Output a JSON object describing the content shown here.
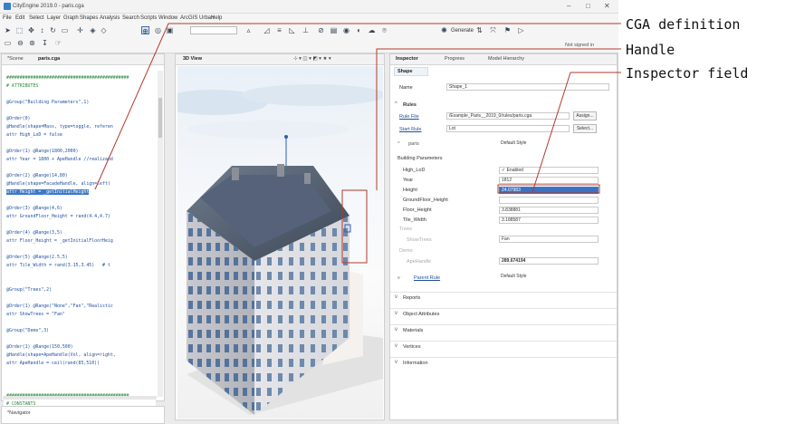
{
  "window": {
    "title": "CityEngine 2019.0 - paris.cga",
    "minimize": "–",
    "maximize": "□",
    "close": "✕"
  },
  "menu": [
    "File",
    "Edit",
    "Select",
    "Layer",
    "Graph",
    "Shapes",
    "Analysis",
    "Search",
    "Scripts",
    "Window",
    "ArcGIS Urban",
    "Help"
  ],
  "toolbar": {
    "generate_label": "Generate",
    "signin_label": "Not signed in"
  },
  "left_panel": {
    "tabs": [
      "*Scene",
      "paris.cga"
    ],
    "code": [
      {
        "text": "##############################################",
        "kind": "comment"
      },
      {
        "text": "# ATTRIBUTES",
        "kind": "comment"
      },
      {
        "text": "",
        "kind": "code"
      },
      {
        "text": "@Group(\"Building Parameters\",1)",
        "kind": "code"
      },
      {
        "text": "",
        "kind": "code"
      },
      {
        "text": "@Order(0)",
        "kind": "code"
      },
      {
        "text": "@Handle(shape=Mass, type=toggle, referen",
        "kind": "code"
      },
      {
        "text": "attr High_LoD = false",
        "kind": "code"
      },
      {
        "text": "",
        "kind": "code"
      },
      {
        "text": "@Order(1) @Range(1800,2000)",
        "kind": "code"
      },
      {
        "text": "attr Year = 1800 + ApeHandle //realizand",
        "kind": "code"
      },
      {
        "text": "",
        "kind": "code"
      },
      {
        "text": "@Order(2) @Range(14,80)",
        "kind": "code"
      },
      {
        "text": "@Handle(shape=FacadeHandle, align=left)",
        "kind": "code"
      },
      {
        "text": "attr Height = _getInitialHeight",
        "kind": "selected"
      },
      {
        "text": "",
        "kind": "code"
      },
      {
        "text": "@Order(3) @Range(4,6)",
        "kind": "code"
      },
      {
        "text": "attr GroundFloor_Height = rand(4.4,4.7)",
        "kind": "code"
      },
      {
        "text": "",
        "kind": "code"
      },
      {
        "text": "@Order(4) @Range(3,5)",
        "kind": "code"
      },
      {
        "text": "attr Floor_Height = _getInitialFloorHeig",
        "kind": "code"
      },
      {
        "text": "",
        "kind": "code"
      },
      {
        "text": "@Order(5) @Range(2.5,5)",
        "kind": "code"
      },
      {
        "text": "attr Tile_Width = rand(3.15,3.45)   # t",
        "kind": "code"
      },
      {
        "text": "",
        "kind": "code"
      },
      {
        "text": "",
        "kind": "code"
      },
      {
        "text": "@Group(\"Trees\",2)",
        "kind": "code"
      },
      {
        "text": "",
        "kind": "code"
      },
      {
        "text": "@Order(1) @Range(\"None\",\"Fan\",\"Realistic",
        "kind": "code"
      },
      {
        "text": "attr ShowTrees = \"Fan\"",
        "kind": "code"
      },
      {
        "text": "",
        "kind": "code"
      },
      {
        "text": "@Group(\"Demo\",3)",
        "kind": "code"
      },
      {
        "text": "",
        "kind": "code"
      },
      {
        "text": "@Order(1) @Range(150,500)",
        "kind": "code"
      },
      {
        "text": "@Handle(shape=ApeHandle(Vol, align=right,",
        "kind": "code"
      },
      {
        "text": "attr ApeHandle = ceil(rand(85,510))",
        "kind": "code"
      },
      {
        "text": "",
        "kind": "code"
      },
      {
        "text": "",
        "kind": "code"
      },
      {
        "text": "",
        "kind": "code"
      },
      {
        "text": "##############################################",
        "kind": "comment"
      },
      {
        "text": "# CONSTANTS",
        "kind": "comment"
      }
    ],
    "navigator_tab": "*Navigator"
  },
  "viewport": {
    "tab": "3D View"
  },
  "inspector": {
    "tabs": [
      "Inspector",
      "Progress",
      "Model Hierarchy"
    ],
    "subtab": "Shape",
    "name_label": "Name",
    "name_value": "Shape_1",
    "rules_title": "Rules",
    "rule_file_label": "Rule File",
    "rule_file_value": "/Example_Paris__2019_0/rules/paris.cga",
    "assign_label": "Assign...",
    "start_rule_label": "Start Rule",
    "start_rule_value": "Lot",
    "select_label": "Select...",
    "paris_label": "paris",
    "paris_style": "Default Style",
    "building_params_label": "Building Parameters",
    "attributes": [
      {
        "label": "High_LoD",
        "value": "✓ Enabled"
      },
      {
        "label": "Year",
        "value": "1812"
      },
      {
        "label": "Height",
        "value": "24.07983"
      },
      {
        "label": "GroundFloor_Height",
        "value": ""
      },
      {
        "label": "Floor_Height",
        "value": "3.838881"
      },
      {
        "label": "Tile_Width",
        "value": "3.188587"
      }
    ],
    "trees_label": "Trees",
    "show_trees_label": "ShowTrees",
    "show_trees_value": "Fan",
    "demo_label": "Demo",
    "ape_handle_label": "ApeHandle",
    "ape_handle_value": "289.674194",
    "parent_rule_label": "Parent Rule",
    "parent_style": "Default Style",
    "sections": [
      "Reports",
      "Object Attributes",
      "Materials",
      "Vertices",
      "Information"
    ]
  },
  "callouts": [
    "CGA definition",
    "Handle",
    "Inspector field"
  ]
}
